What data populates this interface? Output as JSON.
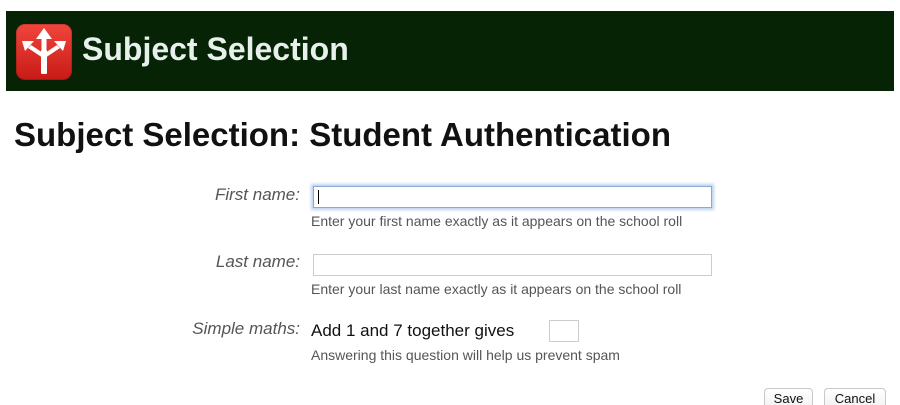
{
  "header": {
    "app_title": "Subject Selection",
    "logo_icon": "arrow-split-icon",
    "background_color": "#062306",
    "logo_color": "#e0312a"
  },
  "page": {
    "title": "Subject Selection: Student Authentication"
  },
  "form": {
    "first_name": {
      "label": "First name:",
      "value": "",
      "help": "Enter your first name exactly as it appears on the school roll"
    },
    "last_name": {
      "label": "Last name:",
      "value": "",
      "help": "Enter your last name exactly as it appears on the school roll"
    },
    "captcha": {
      "label": "Simple maths:",
      "question": "Add 1 and 7 together gives",
      "value": "",
      "help": "Answering this question will help us prevent spam"
    }
  },
  "actions": {
    "save_label": "Save",
    "cancel_label": "Cancel"
  }
}
